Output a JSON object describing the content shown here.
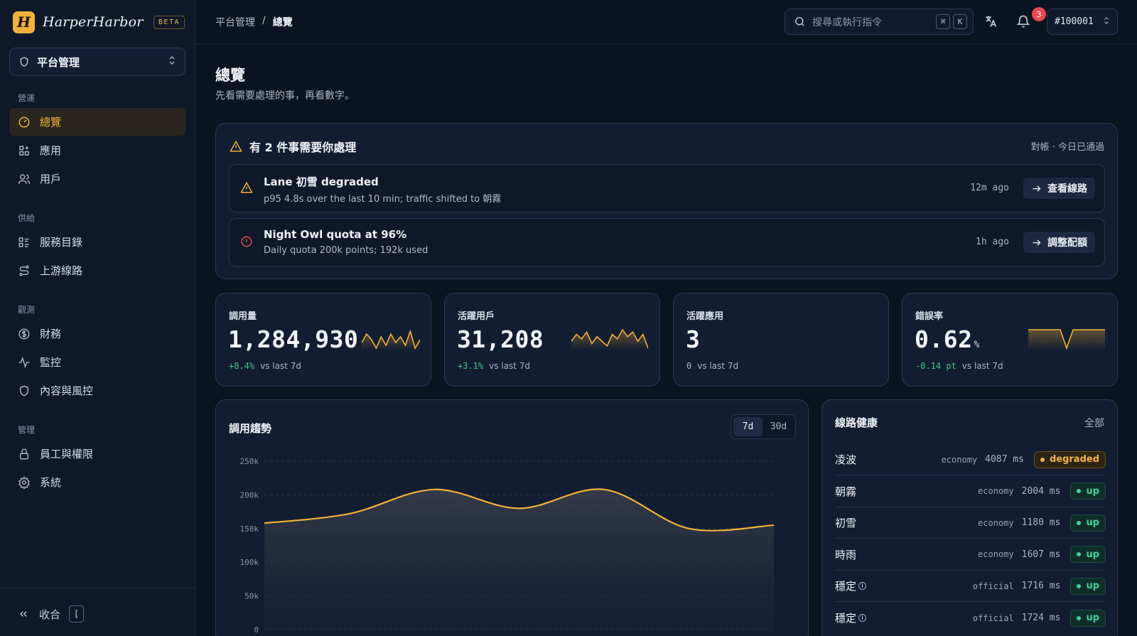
{
  "brand": {
    "logo_letter": "H",
    "name": "HarperHarbor",
    "badge": "BETA",
    "color": "#f0b23a"
  },
  "workspace": {
    "label": "平台管理"
  },
  "nav": {
    "sections": [
      {
        "title": "營運",
        "items": [
          {
            "label": "總覽",
            "icon": "gauge-icon",
            "active": true
          },
          {
            "label": "應用",
            "icon": "apps-icon"
          },
          {
            "label": "用戶",
            "icon": "users-icon"
          }
        ]
      },
      {
        "title": "供給",
        "items": [
          {
            "label": "服務目錄",
            "icon": "catalog-icon"
          },
          {
            "label": "上游線路",
            "icon": "route-icon"
          }
        ]
      },
      {
        "title": "觀測",
        "items": [
          {
            "label": "財務",
            "icon": "dollar-icon"
          },
          {
            "label": "監控",
            "icon": "activity-icon"
          },
          {
            "label": "內容與風控",
            "icon": "shield-icon"
          }
        ]
      },
      {
        "title": "管理",
        "items": [
          {
            "label": "員工與權限",
            "icon": "lock-icon"
          },
          {
            "label": "系統",
            "icon": "gear-icon"
          }
        ]
      }
    ],
    "collapse_label": "收合",
    "collapse_key": "["
  },
  "topbar": {
    "breadcrumb": [
      "平台管理",
      "總覽"
    ],
    "breadcrumb_sep": "/",
    "search_placeholder": "搜尋或執行指令",
    "search_keys": [
      "⌘",
      "K"
    ],
    "notification_count": "3",
    "tenant": "#100001"
  },
  "page": {
    "title": "總覽",
    "subtitle": "先看需要處理的事，再看數字。"
  },
  "alerts": {
    "heading": "有 2 件事需要你處理",
    "meta": "對帳 · 今日已通過",
    "items": [
      {
        "title": "Lane 初雪 degraded",
        "detail": "p95 4.8s over the last 10 min; traffic shifted to 朝霧",
        "ago": "12m ago",
        "action": "查看線路",
        "severity": "warning",
        "color": "#f0b23a"
      },
      {
        "title": "Night Owl quota at 96%",
        "detail": "Daily quota 200k points; 192k used",
        "ago": "1h ago",
        "action": "調整配額",
        "severity": "error",
        "color": "#e5484d"
      }
    ]
  },
  "stats": [
    {
      "label": "調用量",
      "value": "1,284,930",
      "unit": "",
      "delta": "+8.4%",
      "delta_text": "vs last 7d",
      "spark": [
        6,
        9,
        7,
        4,
        8,
        5,
        9,
        6,
        8,
        5,
        10,
        4,
        7
      ]
    },
    {
      "label": "活躍用戶",
      "value": "31,208",
      "unit": "",
      "delta": "+3.1%",
      "delta_text": "vs last 7d",
      "spark": [
        5,
        8,
        6,
        9,
        4,
        7,
        5,
        3,
        8,
        6,
        10,
        7,
        9,
        5,
        8,
        2
      ]
    },
    {
      "label": "活躍應用",
      "value": "3",
      "unit": "",
      "delta": "0",
      "delta_text": "vs last 7d",
      "spark": []
    },
    {
      "label": "錯誤率",
      "value": "0.62",
      "unit": "%",
      "delta": "-0.14 pt",
      "delta_text": "vs last 7d",
      "spark": [
        10,
        10,
        10,
        10,
        10,
        10,
        2,
        10,
        10,
        10,
        10,
        10,
        10
      ]
    }
  ],
  "trend": {
    "title": "調用趨勢",
    "ranges": [
      "7d",
      "30d"
    ],
    "selected_range": "7d"
  },
  "chart_data": {
    "type": "area",
    "title": "調用趨勢",
    "ylim": [
      0,
      250000
    ],
    "y_ticks": [
      "0",
      "50k",
      "100k",
      "150k",
      "200k",
      "250k"
    ],
    "series": [
      {
        "values": [
          158000,
          172000,
          208000,
          180000,
          208000,
          150000,
          155000
        ],
        "color": "#f0b23a"
      }
    ]
  },
  "health": {
    "title": "線路健康",
    "all_label": "全部",
    "rows": [
      {
        "name": "凌波",
        "info": false,
        "tier": "economy",
        "latency": "4087 ms",
        "status": "degraded"
      },
      {
        "name": "朝霧",
        "info": false,
        "tier": "economy",
        "latency": "2004 ms",
        "status": "up"
      },
      {
        "name": "初雪",
        "info": false,
        "tier": "economy",
        "latency": "1180 ms",
        "status": "up"
      },
      {
        "name": "時雨",
        "info": false,
        "tier": "economy",
        "latency": "1607 ms",
        "status": "up"
      },
      {
        "name": "穩定",
        "info": true,
        "tier": "official",
        "latency": "1716 ms",
        "status": "up"
      },
      {
        "name": "穩定",
        "info": true,
        "tier": "official",
        "latency": "1724 ms",
        "status": "up"
      }
    ]
  }
}
